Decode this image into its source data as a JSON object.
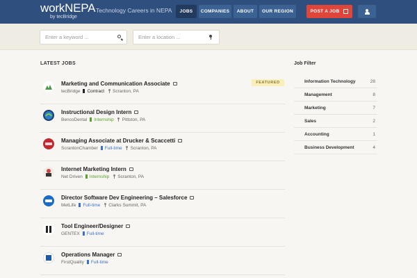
{
  "header": {
    "logo_main": "workNEPA",
    "logo_sub": "by tecBridge",
    "tagline": "Technology Careers in NEPA",
    "nav": [
      "JOBS",
      "COMPANIES",
      "ABOUT",
      "OUR REGION"
    ],
    "active_nav": "JOBS",
    "post_job": "POST A JOB",
    "user_icon": "user-icon"
  },
  "search": {
    "keyword_placeholder": "Enter a keyword ...",
    "location_placeholder": "Enter a location ..."
  },
  "main": {
    "heading": "LATEST JOBS",
    "jobs": [
      {
        "title": "Marketing and Communication Associate",
        "company": "tecBridge",
        "type": "Contract",
        "location": "Scranton, PA",
        "featured": "FEATURED",
        "type_color": "#222222"
      },
      {
        "title": "Instructional Design Intern",
        "company": "BencoDental",
        "type": "Internship",
        "location": "Pittston, PA",
        "type_color": "#5aa02c"
      },
      {
        "title": "Managing Associate at Drucker & Scaccetti",
        "company": "ScrantonChamber",
        "type": "Full-time",
        "location": "Scranton, PA",
        "type_color": "#3b6fd1"
      },
      {
        "title": "Internet Marketing Intern",
        "company": "Net Driven",
        "type": "Internship",
        "location": "Scranton, PA",
        "type_color": "#5aa02c"
      },
      {
        "title": "Director Software Dev Engineering – Salesforce",
        "company": "MetLife",
        "type": "Full-time",
        "location": "Clarks Summit, PA",
        "type_color": "#3b6fd1"
      },
      {
        "title": "Tool Engineer/Designer",
        "company": "GENTEX",
        "type": "Full-time",
        "location": "",
        "type_color": "#3b6fd1"
      },
      {
        "title": "Operations Manager",
        "company": "FirstQuality",
        "type": "Full-time",
        "location": "",
        "type_color": "#3b6fd1"
      }
    ]
  },
  "filter": {
    "heading": "Job Filter",
    "items": [
      {
        "label": "Information Technology",
        "count": "28"
      },
      {
        "label": "Management",
        "count": "8"
      },
      {
        "label": "Marketing",
        "count": "7"
      },
      {
        "label": "Sales",
        "count": "2"
      },
      {
        "label": "Accounting",
        "count": "1"
      },
      {
        "label": "Business Development",
        "count": "4"
      }
    ]
  },
  "colors": {
    "header_bg": "#2f4f7e",
    "accent_red": "#e0453a",
    "featured_bg": "#faefb8"
  }
}
